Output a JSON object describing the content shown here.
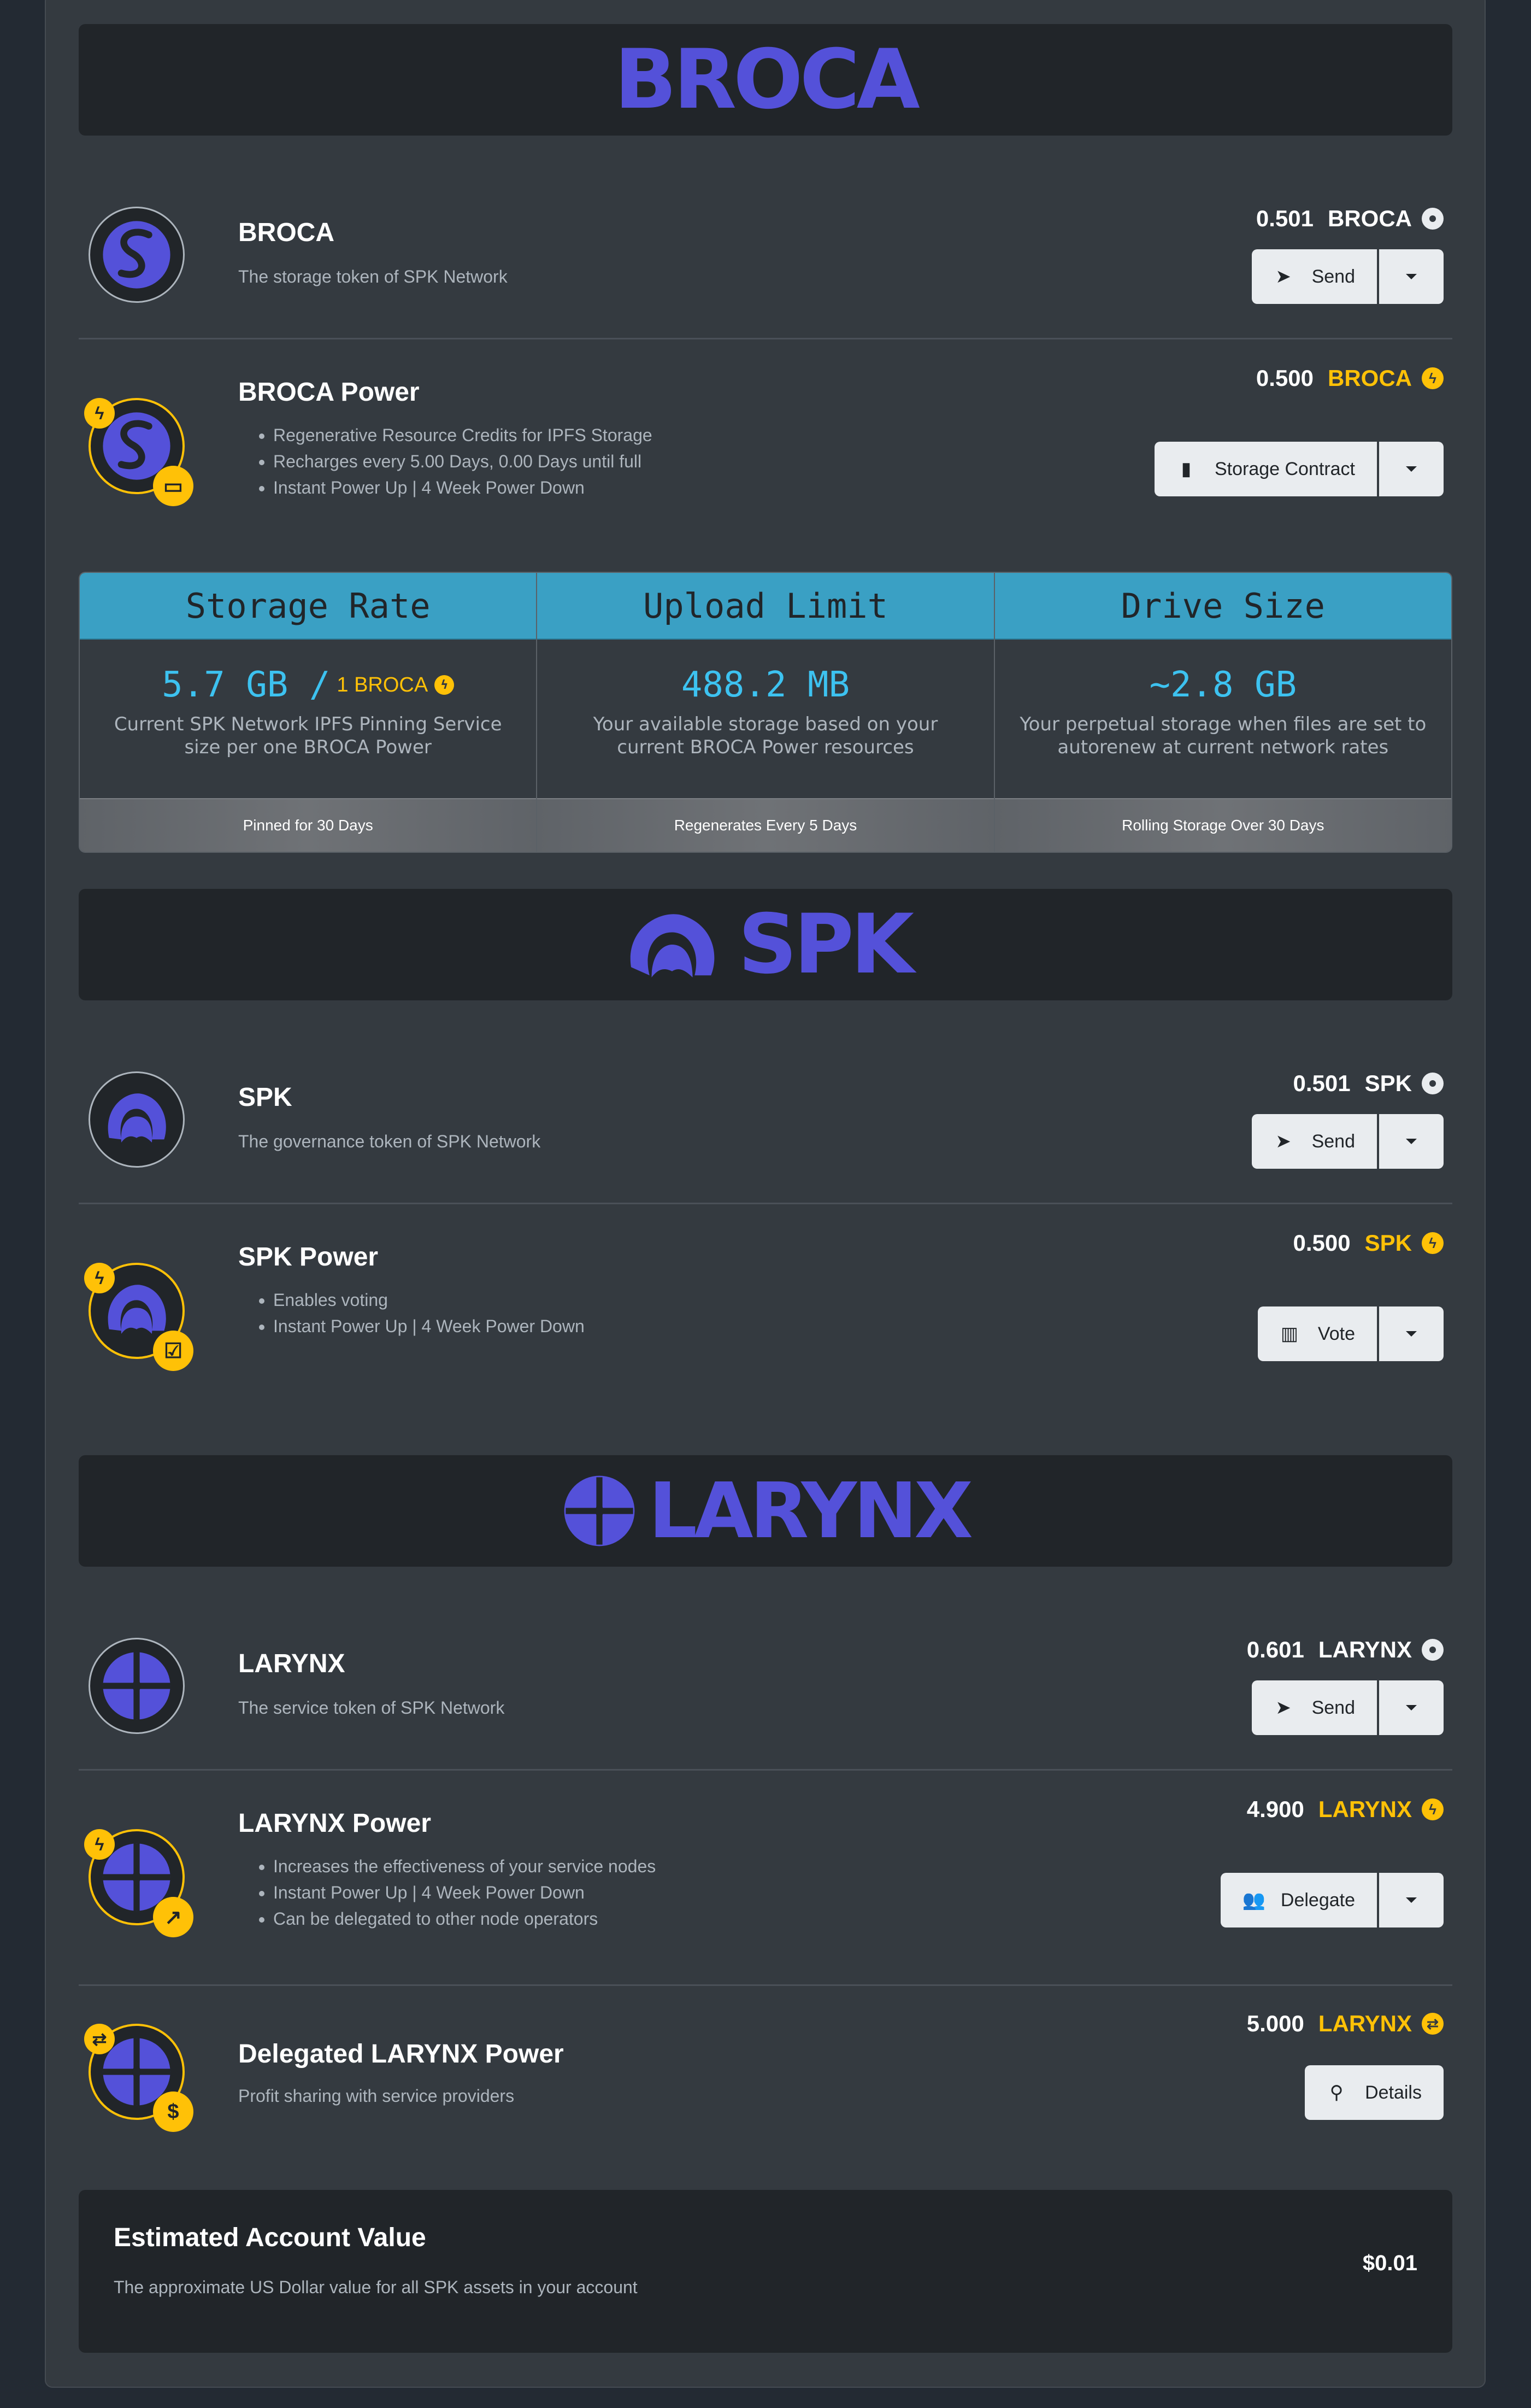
{
  "colors": {
    "brand": "#5451d9",
    "gold": "#ffc107",
    "cyan": "#3dc2f0",
    "panel": "#343a40",
    "dark": "#212529"
  },
  "banners": {
    "broca": "BROCA",
    "spk": "SPK",
    "larynx": "LARYNX"
  },
  "broca": {
    "title": "BROCA",
    "desc": "The storage token of SPK Network",
    "amount": "0.501",
    "symbol": "BROCA",
    "symbol_icon": "coin-icon",
    "button": "Send",
    "button_icon": "paper-plane-icon"
  },
  "broca_power": {
    "title": "BROCA Power",
    "bullets": [
      "Regenerative Resource Credits for IPFS Storage",
      "Recharges every 5.00 Days, 0.00 Days until full",
      "Instant Power Up | 4 Week Power Down"
    ],
    "amount": "0.500",
    "symbol": "BROCA",
    "symbol_icon": "bolt-icon",
    "button": "Storage Contract",
    "button_icon": "file-icon"
  },
  "storage": [
    {
      "title": "Storage Rate",
      "value": "5.7 GB /",
      "value_small": "1 BROCA",
      "desc": "Current SPK Network IPFS Pinning Service size per one BROCA Power",
      "foot": "Pinned for 30 Days"
    },
    {
      "title": "Upload Limit",
      "value": "488.2 MB",
      "value_small": "",
      "desc": "Your available storage based on your current BROCA Power resources",
      "foot": "Regenerates Every 5 Days"
    },
    {
      "title": "Drive Size",
      "value": "~2.8 GB",
      "value_small": "",
      "desc": "Your perpetual storage when files are set to autorenew at current network rates",
      "foot": "Rolling Storage Over 30 Days"
    }
  ],
  "spk": {
    "title": "SPK",
    "desc": "The governance token of SPK Network",
    "amount": "0.501",
    "symbol": "SPK",
    "button": "Send"
  },
  "spk_power": {
    "title": "SPK Power",
    "bullets": [
      "Enables voting",
      "Instant Power Up | 4 Week Power Down"
    ],
    "amount": "0.500",
    "symbol": "SPK",
    "button": "Vote",
    "button_icon": "ballot-icon"
  },
  "larynx": {
    "title": "LARYNX",
    "desc": "The service token of SPK Network",
    "amount": "0.601",
    "symbol": "LARYNX",
    "button": "Send"
  },
  "larynx_power": {
    "title": "LARYNX Power",
    "bullets": [
      "Increases the effectiveness of your service nodes",
      "Instant Power Up | 4 Week Power Down",
      "Can be delegated to other node operators"
    ],
    "amount": "4.900",
    "symbol": "LARYNX",
    "button": "Delegate",
    "button_icon": "users-icon"
  },
  "delegated": {
    "title": "Delegated LARYNX Power",
    "desc": "Profit sharing with service providers",
    "amount": "5.000",
    "symbol": "LARYNX",
    "symbol_icon": "exchange-icon",
    "button": "Details",
    "button_icon": "search-icon"
  },
  "estimate": {
    "title": "Estimated Account Value",
    "desc": "The approximate US Dollar value for all SPK assets in your account",
    "value": "$0.01"
  }
}
